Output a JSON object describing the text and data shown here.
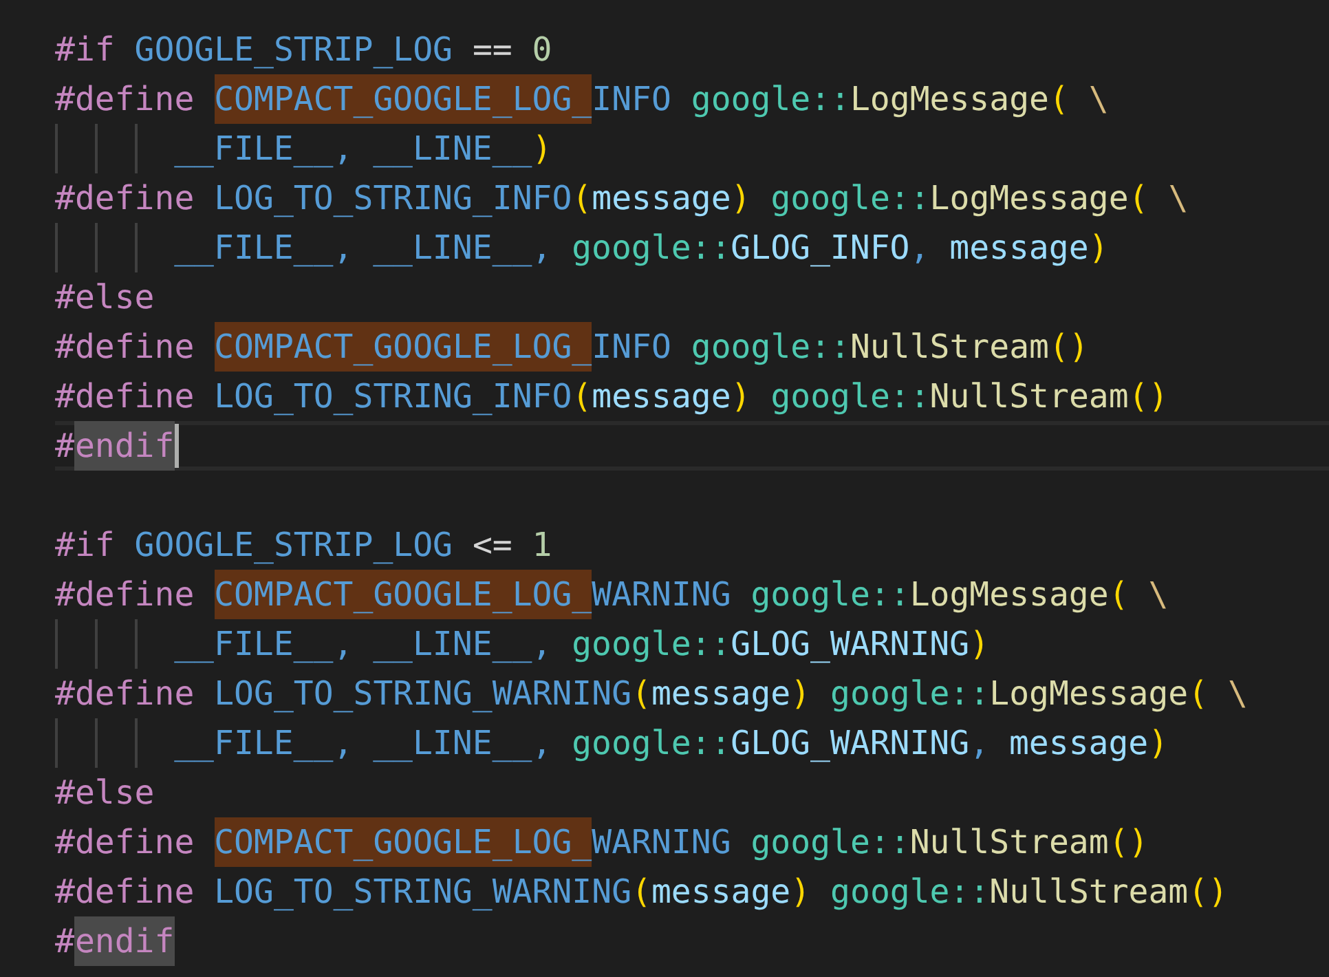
{
  "editor": {
    "lines": [
      {
        "kind": "code",
        "tokens": [
          {
            "kind": "keyword",
            "text": "#if "
          },
          {
            "kind": "macro",
            "text": "GOOGLE_STRIP_LOG "
          },
          {
            "kind": "operator",
            "text": "== "
          },
          {
            "kind": "number",
            "text": "0"
          }
        ]
      },
      {
        "kind": "code",
        "tokens": [
          {
            "kind": "keyword",
            "text": "#define "
          },
          {
            "kind": "macro",
            "text": "COMPACT_GOOGLE_LOG_",
            "highlighted": true
          },
          {
            "kind": "macro",
            "text": "INFO "
          },
          {
            "kind": "namespace",
            "text": "google::"
          },
          {
            "kind": "func",
            "text": "LogMessage"
          },
          {
            "kind": "bracket",
            "text": "( "
          },
          {
            "kind": "escape",
            "text": "\\"
          }
        ]
      },
      {
        "kind": "continuation",
        "tokens": [
          {
            "kind": "macro",
            "text": "__FILE__, __LINE__"
          },
          {
            "kind": "bracket",
            "text": ")"
          }
        ]
      },
      {
        "kind": "code",
        "tokens": [
          {
            "kind": "keyword",
            "text": "#define "
          },
          {
            "kind": "macro",
            "text": "LOG_TO_STRING_INFO"
          },
          {
            "kind": "bracket",
            "text": "("
          },
          {
            "kind": "param",
            "text": "message"
          },
          {
            "kind": "bracket",
            "text": ") "
          },
          {
            "kind": "namespace",
            "text": "google::"
          },
          {
            "kind": "func",
            "text": "LogMessage"
          },
          {
            "kind": "bracket",
            "text": "( "
          },
          {
            "kind": "escape",
            "text": "\\"
          }
        ]
      },
      {
        "kind": "continuation",
        "tokens": [
          {
            "kind": "macro",
            "text": "__FILE__, __LINE__, "
          },
          {
            "kind": "namespace",
            "text": "google::"
          },
          {
            "kind": "param",
            "text": "GLOG_INFO"
          },
          {
            "kind": "macro",
            "text": ", "
          },
          {
            "kind": "param",
            "text": "message"
          },
          {
            "kind": "bracket",
            "text": ")"
          }
        ]
      },
      {
        "kind": "code",
        "tokens": [
          {
            "kind": "keyword",
            "text": "#else"
          }
        ]
      },
      {
        "kind": "code",
        "tokens": [
          {
            "kind": "keyword",
            "text": "#define "
          },
          {
            "kind": "macro",
            "text": "COMPACT_GOOGLE_LOG_",
            "highlighted": true
          },
          {
            "kind": "macro",
            "text": "INFO "
          },
          {
            "kind": "namespace",
            "text": "google::"
          },
          {
            "kind": "func",
            "text": "NullStream"
          },
          {
            "kind": "bracket",
            "text": "()"
          }
        ]
      },
      {
        "kind": "code",
        "tokens": [
          {
            "kind": "keyword",
            "text": "#define "
          },
          {
            "kind": "macro",
            "text": "LOG_TO_STRING_INFO"
          },
          {
            "kind": "bracket",
            "text": "("
          },
          {
            "kind": "param",
            "text": "message"
          },
          {
            "kind": "bracket",
            "text": ") "
          },
          {
            "kind": "namespace",
            "text": "google::"
          },
          {
            "kind": "func",
            "text": "NullStream"
          },
          {
            "kind": "bracket",
            "text": "()"
          }
        ]
      },
      {
        "kind": "code",
        "current": true,
        "cursor": true,
        "tokens": [
          {
            "kind": "keyword",
            "text": "#"
          },
          {
            "kind": "keyword",
            "text": "endif",
            "highlighted": true
          }
        ]
      },
      {
        "kind": "blank"
      },
      {
        "kind": "code",
        "tokens": [
          {
            "kind": "keyword",
            "text": "#if "
          },
          {
            "kind": "macro",
            "text": "GOOGLE_STRIP_LOG "
          },
          {
            "kind": "operator",
            "text": "<= "
          },
          {
            "kind": "number",
            "text": "1"
          }
        ]
      },
      {
        "kind": "code",
        "tokens": [
          {
            "kind": "keyword",
            "text": "#define "
          },
          {
            "kind": "macro",
            "text": "COMPACT_GOOGLE_LOG_",
            "highlighted": true
          },
          {
            "kind": "macro",
            "text": "WARNING "
          },
          {
            "kind": "namespace",
            "text": "google::"
          },
          {
            "kind": "func",
            "text": "LogMessage"
          },
          {
            "kind": "bracket",
            "text": "( "
          },
          {
            "kind": "escape",
            "text": "\\"
          }
        ]
      },
      {
        "kind": "continuation",
        "tokens": [
          {
            "kind": "macro",
            "text": "__FILE__, __LINE__, "
          },
          {
            "kind": "namespace",
            "text": "google::"
          },
          {
            "kind": "param",
            "text": "GLOG_WARNING"
          },
          {
            "kind": "bracket",
            "text": ")"
          }
        ]
      },
      {
        "kind": "code",
        "tokens": [
          {
            "kind": "keyword",
            "text": "#define "
          },
          {
            "kind": "macro",
            "text": "LOG_TO_STRING_WARNING"
          },
          {
            "kind": "bracket",
            "text": "("
          },
          {
            "kind": "param",
            "text": "message"
          },
          {
            "kind": "bracket",
            "text": ") "
          },
          {
            "kind": "namespace",
            "text": "google::"
          },
          {
            "kind": "func",
            "text": "LogMessage"
          },
          {
            "kind": "bracket",
            "text": "( "
          },
          {
            "kind": "escape",
            "text": "\\"
          }
        ]
      },
      {
        "kind": "continuation",
        "tokens": [
          {
            "kind": "macro",
            "text": "__FILE__, __LINE__, "
          },
          {
            "kind": "namespace",
            "text": "google::"
          },
          {
            "kind": "param",
            "text": "GLOG_WARNING"
          },
          {
            "kind": "macro",
            "text": ", "
          },
          {
            "kind": "param",
            "text": "message"
          },
          {
            "kind": "bracket",
            "text": ")"
          }
        ]
      },
      {
        "kind": "code",
        "tokens": [
          {
            "kind": "keyword",
            "text": "#else"
          }
        ]
      },
      {
        "kind": "code",
        "tokens": [
          {
            "kind": "keyword",
            "text": "#define "
          },
          {
            "kind": "macro",
            "text": "COMPACT_GOOGLE_LOG_",
            "highlighted": true
          },
          {
            "kind": "macro",
            "text": "WARNING "
          },
          {
            "kind": "namespace",
            "text": "google::"
          },
          {
            "kind": "func",
            "text": "NullStream"
          },
          {
            "kind": "bracket",
            "text": "()"
          }
        ]
      },
      {
        "kind": "code",
        "tokens": [
          {
            "kind": "keyword",
            "text": "#define "
          },
          {
            "kind": "macro",
            "text": "LOG_TO_STRING_WARNING"
          },
          {
            "kind": "bracket",
            "text": "("
          },
          {
            "kind": "param",
            "text": "message"
          },
          {
            "kind": "bracket",
            "text": ") "
          },
          {
            "kind": "namespace",
            "text": "google::"
          },
          {
            "kind": "func",
            "text": "NullStream"
          },
          {
            "kind": "bracket",
            "text": "()"
          }
        ]
      },
      {
        "kind": "code",
        "tokens": [
          {
            "kind": "keyword",
            "text": "#"
          },
          {
            "kind": "keyword",
            "text": "endif",
            "highlighted": true
          }
        ]
      }
    ]
  }
}
